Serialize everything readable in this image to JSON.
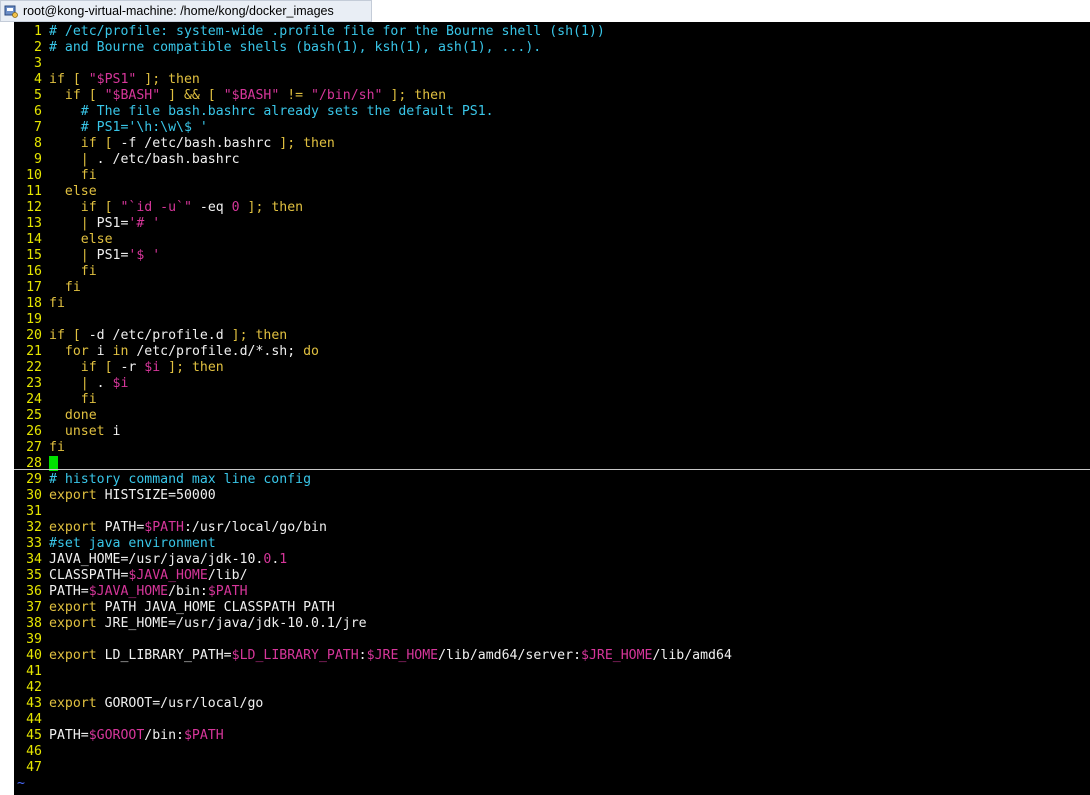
{
  "window": {
    "title": "root@kong-virtual-machine: /home/kong/docker_images"
  },
  "colors": {
    "comment": "#39c6e8",
    "keyword": "#e0c040",
    "string": "#d6369a",
    "text": "#f0f0f0",
    "line_number": "#e6e600",
    "cursor": "#00e000",
    "tilde": "#4a6bff"
  },
  "editor": {
    "lines": [
      {
        "n": "1",
        "parts": [
          {
            "t": "# /etc/profile: system-wide .profile file for the Bourne shell (sh(1))",
            "c": "comment"
          }
        ]
      },
      {
        "n": "2",
        "parts": [
          {
            "t": "# and Bourne compatible shells (bash(1), ksh(1), ash(1), ...).",
            "c": "comment"
          }
        ]
      },
      {
        "n": "3",
        "parts": []
      },
      {
        "n": "4",
        "parts": [
          {
            "t": "if [ ",
            "c": "key"
          },
          {
            "t": "\"$PS1\"",
            "c": "str"
          },
          {
            "t": " ]; then",
            "c": "key"
          }
        ]
      },
      {
        "n": "5",
        "parts": [
          {
            "t": "  if [ ",
            "c": "key"
          },
          {
            "t": "\"$BASH\"",
            "c": "str"
          },
          {
            "t": " ] && [ ",
            "c": "key"
          },
          {
            "t": "\"$BASH\"",
            "c": "str"
          },
          {
            "t": " != ",
            "c": "key"
          },
          {
            "t": "\"/bin/sh\"",
            "c": "str"
          },
          {
            "t": " ]; then",
            "c": "key"
          }
        ]
      },
      {
        "n": "6",
        "parts": [
          {
            "t": "    # The file bash.bashrc already sets the default PS1.",
            "c": "comment"
          }
        ]
      },
      {
        "n": "7",
        "parts": [
          {
            "t": "    # PS1='\\h:\\w\\$ '",
            "c": "comment"
          }
        ]
      },
      {
        "n": "8",
        "parts": [
          {
            "t": "    if [ ",
            "c": "key"
          },
          {
            "t": "-f /etc/bash.bashrc",
            "c": "text"
          },
          {
            "t": " ]; then",
            "c": "key"
          }
        ]
      },
      {
        "n": "9",
        "parts": [
          {
            "t": "    | ",
            "c": "key"
          },
          {
            "t": ". /etc/bash.bashrc",
            "c": "text"
          }
        ]
      },
      {
        "n": "10",
        "parts": [
          {
            "t": "    fi",
            "c": "key"
          }
        ]
      },
      {
        "n": "11",
        "parts": [
          {
            "t": "  else",
            "c": "key"
          }
        ]
      },
      {
        "n": "12",
        "parts": [
          {
            "t": "    if [ ",
            "c": "key"
          },
          {
            "t": "\"`id -u`\"",
            "c": "str"
          },
          {
            "t": " -eq ",
            "c": "text"
          },
          {
            "t": "0",
            "c": "str"
          },
          {
            "t": " ]; then",
            "c": "key"
          }
        ]
      },
      {
        "n": "13",
        "parts": [
          {
            "t": "    | ",
            "c": "key"
          },
          {
            "t": "PS1=",
            "c": "text"
          },
          {
            "t": "'# '",
            "c": "str"
          }
        ]
      },
      {
        "n": "14",
        "parts": [
          {
            "t": "    else",
            "c": "key"
          }
        ]
      },
      {
        "n": "15",
        "parts": [
          {
            "t": "    | ",
            "c": "key"
          },
          {
            "t": "PS1=",
            "c": "text"
          },
          {
            "t": "'$ '",
            "c": "str"
          }
        ]
      },
      {
        "n": "16",
        "parts": [
          {
            "t": "    fi",
            "c": "key"
          }
        ]
      },
      {
        "n": "17",
        "parts": [
          {
            "t": "  fi",
            "c": "key"
          }
        ]
      },
      {
        "n": "18",
        "parts": [
          {
            "t": "fi",
            "c": "key"
          }
        ]
      },
      {
        "n": "19",
        "parts": []
      },
      {
        "n": "20",
        "parts": [
          {
            "t": "if [ ",
            "c": "key"
          },
          {
            "t": "-d /etc/profile.d",
            "c": "text"
          },
          {
            "t": " ]; then",
            "c": "key"
          }
        ]
      },
      {
        "n": "21",
        "parts": [
          {
            "t": "  for ",
            "c": "key"
          },
          {
            "t": "i ",
            "c": "text"
          },
          {
            "t": "in",
            "c": "key"
          },
          {
            "t": " /etc/profile.d/*.sh; ",
            "c": "text"
          },
          {
            "t": "do",
            "c": "key"
          }
        ]
      },
      {
        "n": "22",
        "parts": [
          {
            "t": "    if [ ",
            "c": "key"
          },
          {
            "t": "-r ",
            "c": "text"
          },
          {
            "t": "$i",
            "c": "str"
          },
          {
            "t": " ]; then",
            "c": "key"
          }
        ]
      },
      {
        "n": "23",
        "parts": [
          {
            "t": "    | ",
            "c": "key"
          },
          {
            "t": ". ",
            "c": "text"
          },
          {
            "t": "$i",
            "c": "str"
          }
        ]
      },
      {
        "n": "24",
        "parts": [
          {
            "t": "    fi",
            "c": "key"
          }
        ]
      },
      {
        "n": "25",
        "parts": [
          {
            "t": "  done",
            "c": "key"
          }
        ]
      },
      {
        "n": "26",
        "parts": [
          {
            "t": "  unset ",
            "c": "key"
          },
          {
            "t": "i",
            "c": "text"
          }
        ]
      },
      {
        "n": "27",
        "parts": [
          {
            "t": "fi",
            "c": "key"
          }
        ]
      },
      {
        "n": "28",
        "parts": [],
        "cursor": true
      },
      {
        "n": "29",
        "parts": [
          {
            "t": "# history command max line config",
            "c": "comment"
          }
        ]
      },
      {
        "n": "30",
        "parts": [
          {
            "t": "export ",
            "c": "key"
          },
          {
            "t": "HISTSIZE=50000",
            "c": "text"
          }
        ]
      },
      {
        "n": "31",
        "parts": []
      },
      {
        "n": "32",
        "parts": [
          {
            "t": "export ",
            "c": "key"
          },
          {
            "t": "PATH=",
            "c": "text"
          },
          {
            "t": "$PATH",
            "c": "str"
          },
          {
            "t": ":/usr/local/go/bin",
            "c": "text"
          }
        ]
      },
      {
        "n": "33",
        "parts": [
          {
            "t": "#set java environment",
            "c": "comment"
          }
        ]
      },
      {
        "n": "34",
        "parts": [
          {
            "t": "JAVA_HOME=/usr/java/jdk-10.",
            "c": "text"
          },
          {
            "t": "0",
            "c": "str"
          },
          {
            "t": ".",
            "c": "text"
          },
          {
            "t": "1",
            "c": "str"
          }
        ]
      },
      {
        "n": "35",
        "parts": [
          {
            "t": "CLASSPATH=",
            "c": "text"
          },
          {
            "t": "$JAVA_HOME",
            "c": "str"
          },
          {
            "t": "/lib/",
            "c": "text"
          }
        ]
      },
      {
        "n": "36",
        "parts": [
          {
            "t": "PATH=",
            "c": "text"
          },
          {
            "t": "$JAVA_HOME",
            "c": "str"
          },
          {
            "t": "/bin:",
            "c": "text"
          },
          {
            "t": "$PATH",
            "c": "str"
          }
        ]
      },
      {
        "n": "37",
        "parts": [
          {
            "t": "export ",
            "c": "key"
          },
          {
            "t": "PATH JAVA_HOME CLASSPATH PATH",
            "c": "text"
          }
        ]
      },
      {
        "n": "38",
        "parts": [
          {
            "t": "export ",
            "c": "key"
          },
          {
            "t": "JRE_HOME=/usr/java/jdk-10.0.1/jre",
            "c": "text"
          }
        ]
      },
      {
        "n": "39",
        "parts": []
      },
      {
        "n": "40",
        "parts": [
          {
            "t": "export ",
            "c": "key"
          },
          {
            "t": "LD_LIBRARY_PATH=",
            "c": "text"
          },
          {
            "t": "$LD_LIBRARY_PATH",
            "c": "str"
          },
          {
            "t": ":",
            "c": "text"
          },
          {
            "t": "$JRE_HOME",
            "c": "str"
          },
          {
            "t": "/lib/amd64/server:",
            "c": "text"
          },
          {
            "t": "$JRE_HOME",
            "c": "str"
          },
          {
            "t": "/lib/amd64",
            "c": "text"
          }
        ]
      },
      {
        "n": "41",
        "parts": []
      },
      {
        "n": "42",
        "parts": []
      },
      {
        "n": "43",
        "parts": [
          {
            "t": "export ",
            "c": "key"
          },
          {
            "t": "GOROOT=/usr/local/go",
            "c": "text"
          }
        ]
      },
      {
        "n": "44",
        "parts": []
      },
      {
        "n": "45",
        "parts": [
          {
            "t": "PATH=",
            "c": "text"
          },
          {
            "t": "$GOROOT",
            "c": "str"
          },
          {
            "t": "/bin:",
            "c": "text"
          },
          {
            "t": "$PATH",
            "c": "str"
          }
        ]
      },
      {
        "n": "46",
        "parts": []
      },
      {
        "n": "47",
        "parts": []
      }
    ],
    "tilde_lines": [
      "~"
    ]
  }
}
